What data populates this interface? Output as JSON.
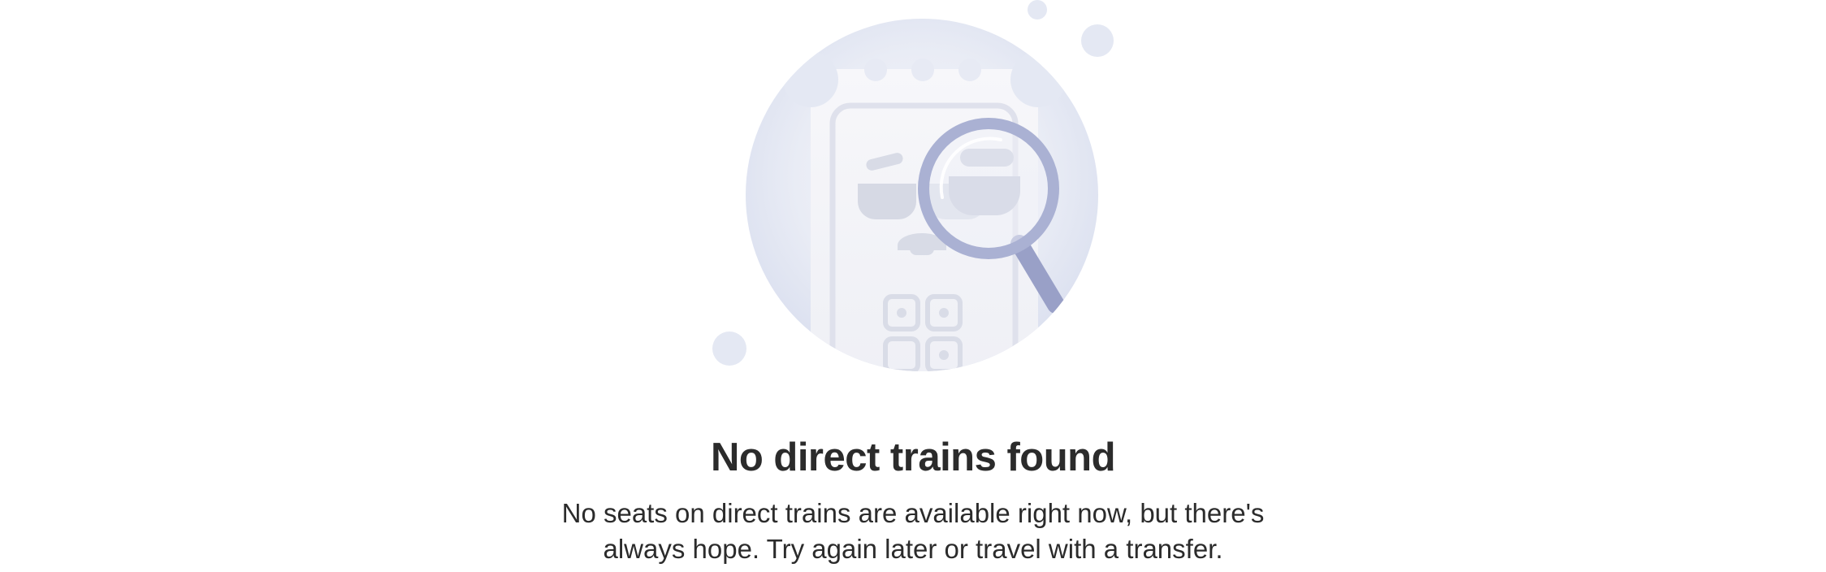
{
  "empty_state": {
    "illustration_icon": "ticket-magnifier-icon",
    "title": "No direct trains found",
    "message_line_1": "No seats on direct trains are available right now, but there's",
    "message_line_2": "always hope. Try again later or travel with a transfer."
  },
  "colors": {
    "background": "#ffffff",
    "text": "#2b2b2b",
    "circle_light": "#eef0f7",
    "circle_edge": "#dde2f1",
    "magnifier": "#a5acd0"
  }
}
